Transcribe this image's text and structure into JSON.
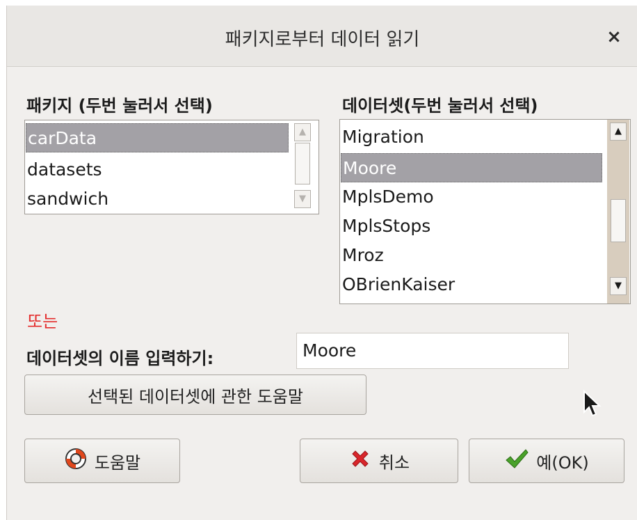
{
  "window": {
    "title": "패키지로부터 데이터 읽기",
    "close_glyph": "×"
  },
  "packages": {
    "label": "패키지 (두번 눌러서 선택)",
    "items": [
      "carData",
      "datasets",
      "sandwich"
    ],
    "selected": "carData"
  },
  "datasets": {
    "label": "데이터셋(두번 눌러서 선택)",
    "items": [
      "Migration",
      "Moore",
      "MplsDemo",
      "MplsStops",
      "Mroz",
      "OBrienKaiser"
    ],
    "selected": "Moore"
  },
  "or_text": "또는",
  "name_entry": {
    "label": "데이터셋의 이름 입력하기:",
    "value": "Moore"
  },
  "buttons": {
    "dataset_help": "선택된 데이터셋에 관한 도움말",
    "help": "도움말",
    "cancel": "취소",
    "ok": "예(OK)"
  },
  "icons": {
    "help": "lifebuoy-icon",
    "cancel": "red-x-icon",
    "ok": "green-check-icon",
    "cursor": "mouse-pointer-icon"
  },
  "colors": {
    "or_text": "#e42b2b",
    "selection": "#a3a1a6"
  }
}
